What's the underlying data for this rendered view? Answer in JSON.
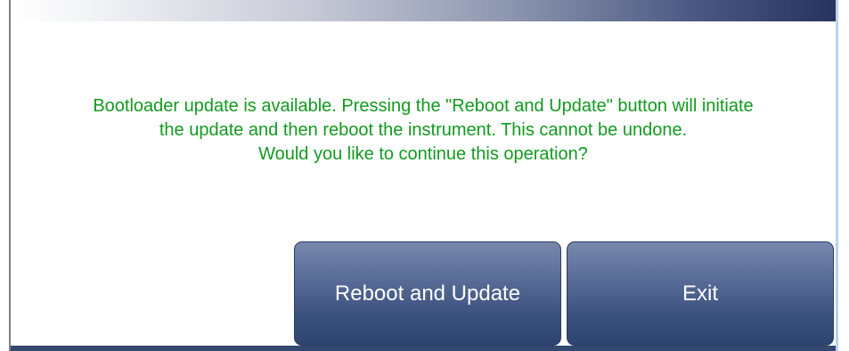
{
  "message": {
    "line1": "Bootloader update is available. Pressing the \"Reboot and Update\" button will initiate",
    "line2": "the update and then reboot the instrument. This cannot be undone.",
    "line3": "Would you like to continue this operation?"
  },
  "buttons": {
    "reboot_label": "Reboot and Update",
    "exit_label": "Exit"
  },
  "colors": {
    "message_text": "#129a1f",
    "button_bg": "#3c527f",
    "title_bar_dark": "#26335f"
  }
}
